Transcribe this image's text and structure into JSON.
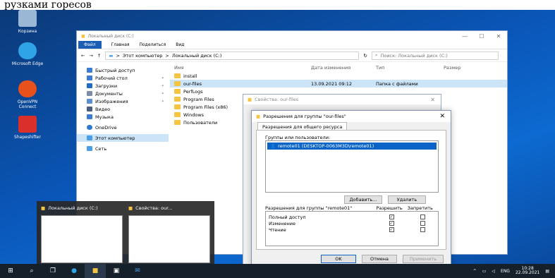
{
  "caption": "рузками горесов",
  "desktop": {
    "icons": [
      {
        "label": "Корзина",
        "color": "#9bb7d6"
      },
      {
        "label": "Microsoft Edge",
        "color": "#2fa4e7"
      },
      {
        "label": "OpenVPN Connect",
        "color": "#e8501c"
      },
      {
        "label": "Shapeshifter",
        "color": "#d9302c"
      }
    ]
  },
  "explorer": {
    "title": "Локальный диск (C:)",
    "ribbon": {
      "file": "Файл",
      "home": "Главная",
      "share": "Поделиться",
      "view": "Вид"
    },
    "address": {
      "pc": "Этот компьютер",
      "sep": ">",
      "drive": "Локальный диск (C:)"
    },
    "search_placeholder": "Поиск: Локальный диск (C:)",
    "nav": [
      {
        "label": "Быстрый доступ",
        "color": "#3a7bd5",
        "pin": false
      },
      {
        "label": "Рабочий стол",
        "color": "#3a7bd5",
        "pin": true
      },
      {
        "label": "Загрузки",
        "color": "#1e6cc8",
        "pin": true
      },
      {
        "label": "Документы",
        "color": "#7a8ea8",
        "pin": true
      },
      {
        "label": "Изображения",
        "color": "#5b8fd1",
        "pin": true
      },
      {
        "label": "Видео",
        "color": "#4a5f7d",
        "pin": false
      },
      {
        "label": "Музыка",
        "color": "#3a7bd5",
        "pin": false
      },
      {
        "label": "OneDrive",
        "color": "#2e79d0",
        "pin": false
      },
      {
        "label": "Этот компьютер",
        "color": "#4aa0e8",
        "pin": false
      },
      {
        "label": "Сеть",
        "color": "#4aa0e8",
        "pin": false
      }
    ],
    "columns": {
      "name": "Имя",
      "date": "Дата изменения",
      "type": "Тип",
      "size": "Размер"
    },
    "files": [
      {
        "name": "install",
        "date": "",
        "type": ""
      },
      {
        "name": "our-files",
        "date": "13.09.2021 09:12",
        "type": "Папка с файлами"
      },
      {
        "name": "PerfLogs",
        "date": "",
        "type": ""
      },
      {
        "name": "Program Files",
        "date": "",
        "type": ""
      },
      {
        "name": "Program Files (x86)",
        "date": "",
        "type": ""
      },
      {
        "name": "Windows",
        "date": "",
        "type": ""
      },
      {
        "name": "Пользователи",
        "date": "",
        "type": ""
      }
    ]
  },
  "props_dialog": {
    "title": "Свойства: our-files"
  },
  "perm_dialog": {
    "title": "Разрешения для группы \"our-files\"",
    "tab": "Разрешения для общего ресурса",
    "groups_label": "Группы или пользователи:",
    "user": "remote01 (DESKTOP-0063M3D\\remote01)",
    "add_button": "Добавить...",
    "remove_button": "Удалить",
    "perm_header": "Разрешения для группы \"remote01\"",
    "allow": "Разрешить",
    "deny": "Запретить",
    "permissions": [
      {
        "name": "Полный доступ",
        "allow": true,
        "deny": false
      },
      {
        "name": "Изменение",
        "allow": true,
        "deny": false
      },
      {
        "name": "Чтение",
        "allow": true,
        "deny": false
      }
    ],
    "ok": "OK",
    "cancel": "Отмена",
    "apply": "Применить"
  },
  "preview": [
    {
      "title": "Локальный диск (C:)"
    },
    {
      "title": "Свойства: our..."
    }
  ],
  "taskbar": {
    "lang": "ENG",
    "time": "10:28",
    "date": "22.09.2021"
  }
}
